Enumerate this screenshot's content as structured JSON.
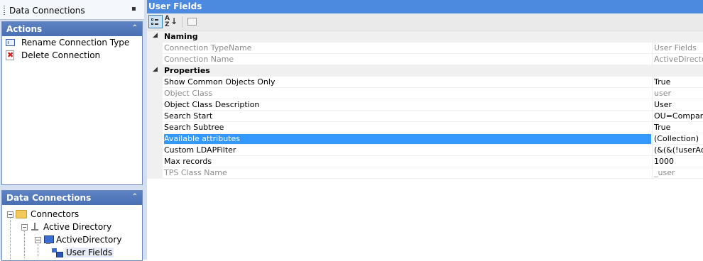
{
  "left_panel": {
    "dock_title": "Data Connections",
    "actions": {
      "title": "Actions",
      "items": [
        {
          "label": "Rename Connection Type",
          "icon": "rename-icon"
        },
        {
          "label": "Delete Connection",
          "icon": "delete-icon"
        }
      ]
    },
    "data_connections": {
      "title": "Data Connections",
      "tree": {
        "connectors": "Connectors",
        "active_directory": "Active Directory",
        "active_directory_child": "ActiveDirectory",
        "user_fields": "User Fields"
      }
    }
  },
  "property_grid": {
    "title": "User Fields",
    "toolbar": [
      "categorized-icon",
      "alphabetical-icon",
      "property-pages-icon"
    ],
    "categories": [
      {
        "label": "Naming",
        "rows": [
          {
            "name": "Connection TypeName",
            "value": "User Fields",
            "readonly": true
          },
          {
            "name": "Connection Name",
            "value": "ActiveDirector",
            "readonly": true
          }
        ]
      },
      {
        "label": "Properties",
        "rows": [
          {
            "name": "Show Common Objects Only",
            "value": "True",
            "readonly": false
          },
          {
            "name": "Object Class",
            "value": "user",
            "readonly": true
          },
          {
            "name": "Object Class Description",
            "value": "User",
            "readonly": false
          },
          {
            "name": "Search Start",
            "value": "OU=Company",
            "readonly": false
          },
          {
            "name": "Search Subtree",
            "value": "True",
            "readonly": false
          },
          {
            "name": "Available attributes",
            "value": "(Collection)",
            "readonly": false,
            "selected": true
          },
          {
            "name": "Custom LDAPFilter",
            "value": "(&(&(!userAcc",
            "readonly": false
          },
          {
            "name": "Max records",
            "value": "1000",
            "readonly": false
          },
          {
            "name": "TPS Class Name",
            "value": "_user",
            "readonly": true
          }
        ]
      }
    ]
  },
  "colors": {
    "panel_header": "#4a70b4",
    "grid_header": "#4c8ae0",
    "selection": "#3399ff",
    "readonly_text": "#8c8c8c"
  }
}
